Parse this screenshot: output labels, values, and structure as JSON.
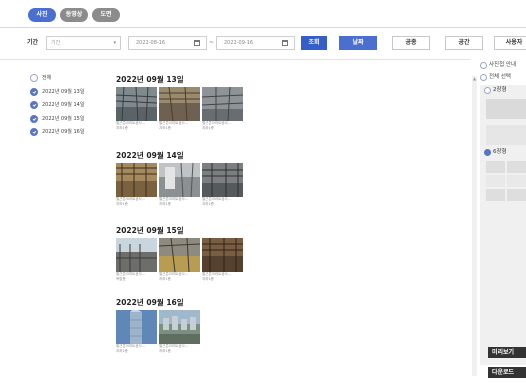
{
  "tabs": [
    {
      "label": "사진",
      "active": true
    },
    {
      "label": "동영상",
      "active": false
    },
    {
      "label": "도면",
      "active": false
    }
  ],
  "filter": {
    "period_label": "기간",
    "period_select": "기간",
    "start_date": "2022-08-16",
    "end_date": "2022-09-16",
    "separator": "~",
    "search_label": "조회",
    "buttons": [
      {
        "label": "날짜",
        "active": true
      },
      {
        "label": "공종",
        "active": false
      },
      {
        "label": "공간",
        "active": false
      },
      {
        "label": "사용자",
        "active": false
      }
    ]
  },
  "tree": [
    {
      "label": "전체",
      "checked": false
    },
    {
      "label": "2022년 09월 13일",
      "checked": true
    },
    {
      "label": "2022년 09월 14일",
      "checked": true
    },
    {
      "label": "2022년 09월 15일",
      "checked": true
    },
    {
      "label": "2022년 09월 16일",
      "checked": true
    }
  ],
  "groups": [
    {
      "title": "2022년 09월 13일",
      "photos": [
        {
          "cap1": "철근콘크리트공사...",
          "cap2": "지하1층"
        },
        {
          "cap1": "철근콘크리트공사...",
          "cap2": "지하1층"
        },
        {
          "cap1": "철근콘크리트공사...",
          "cap2": "지하1층"
        }
      ]
    },
    {
      "title": "2022년 09월 14일",
      "photos": [
        {
          "cap1": "철근콘크리트공사...",
          "cap2": "지하1층"
        },
        {
          "cap1": "철근콘크리트공사...",
          "cap2": "지하1층"
        },
        {
          "cap1": "철근콘크리트공사...",
          "cap2": "지하1층"
        }
      ]
    },
    {
      "title": "2022년 09월 15일",
      "photos": [
        {
          "cap1": "철근콘크리트공사...",
          "cap2": "옥탑층"
        },
        {
          "cap1": "철근콘크리트공사...",
          "cap2": "지하1층"
        },
        {
          "cap1": "철근콘크리트공사...",
          "cap2": "지하1층"
        }
      ]
    },
    {
      "title": "2022년 09월 16일",
      "photos": [
        {
          "cap1": "철근콘크리트공사...",
          "cap2": "지하1층"
        },
        {
          "cap1": "철근콘크리트공사...",
          "cap2": "지하1층"
        }
      ]
    }
  ],
  "right_panel": {
    "option_guide": "사진첩 안내",
    "select_all": "전체 선택",
    "layout_2": "2장형",
    "layout_6": "6장형",
    "preview_button": "미리보기",
    "download_button": "다운로드"
  },
  "colors": {
    "accent": "#4a6fd0",
    "search": "#355ec8",
    "dark_button": "#333333"
  }
}
